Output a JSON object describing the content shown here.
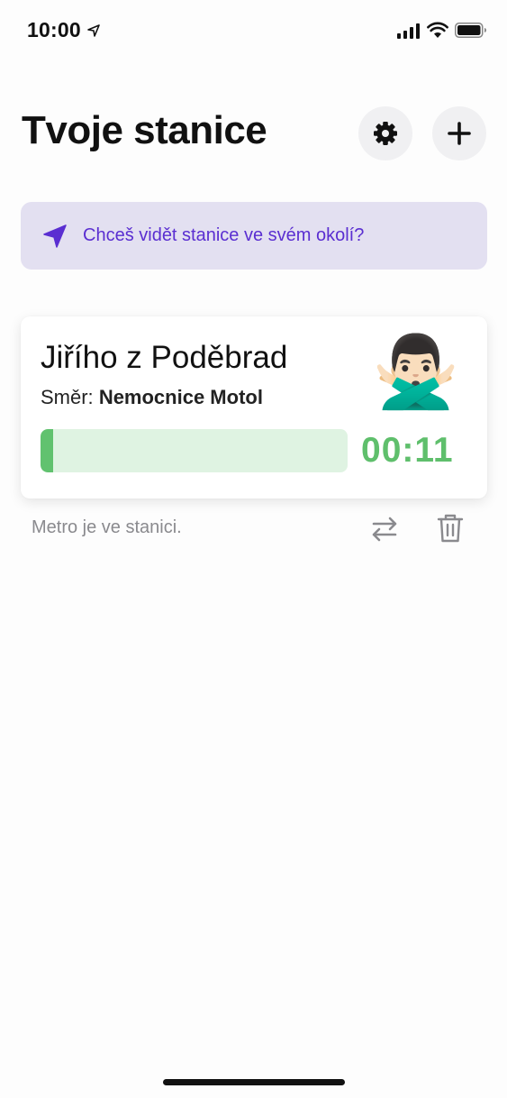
{
  "status_bar": {
    "time": "10:00",
    "icons": [
      "location-arrow-icon",
      "cellular-signal-icon",
      "wifi-icon",
      "battery-icon"
    ]
  },
  "header": {
    "title": "Tvoje stanice",
    "buttons": [
      "gear-icon",
      "plus-icon"
    ]
  },
  "nearby_banner": {
    "text": "Chceš vidět stanice ve svém okolí?",
    "icon": "navigation-arrow-icon",
    "color": "#5a2ed1",
    "background": "#e3e0f1"
  },
  "station_card": {
    "name": "Jiřího z Poděbrad",
    "direction_label": "Směr:",
    "direction_value": "Nemocnice Motol",
    "emoji": "🙅🏻‍♂️",
    "countdown": "00:11",
    "progress": 0.04,
    "colors": {
      "accent": "#5fbf6c",
      "track": "#dff3e2"
    }
  },
  "footer_row": {
    "status": "Metro je ve stanici.",
    "actions": [
      "swap-arrows-icon",
      "trash-icon"
    ]
  }
}
